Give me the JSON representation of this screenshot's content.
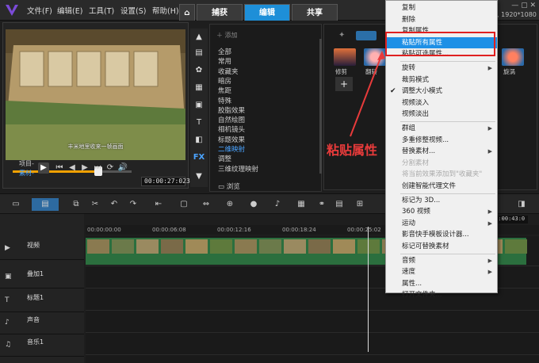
{
  "menubar": {
    "items": [
      "文件(F)",
      "编辑(E)",
      "工具(T)",
      "设置(S)",
      "帮助(H)"
    ],
    "tabs": [
      {
        "label": "捕获"
      },
      {
        "label": "编辑"
      },
      {
        "label": "共享"
      }
    ],
    "resolution": "5, 1920*1080"
  },
  "preview": {
    "subtitle": "丰米地里收来一帧画面",
    "project_label": "项目-",
    "clip_label": "素材-",
    "timecode": "00:00:27:023"
  },
  "library": {
    "add_label": "添加",
    "categories": [
      "全部",
      "常用",
      "收藏夹",
      "暗房",
      "焦距",
      "特殊",
      "胶脂效果",
      "自然绘图",
      "相机镜头",
      "标题效果",
      "二维映射",
      "调整",
      "三维纹理映射"
    ],
    "selected_index": 10,
    "browse_label": "浏览",
    "fx_tab_label": "FX"
  },
  "effects": [
    {
      "label": "修剪"
    },
    {
      "label": "翻转"
    },
    {
      "label": "旋涡"
    }
  ],
  "annotation": {
    "text": "粘贴属性"
  },
  "context_menu": {
    "items": [
      {
        "label": "复制",
        "state": "normal"
      },
      {
        "label": "删除",
        "state": "normal"
      },
      {
        "label": "复制属性",
        "state": "normal"
      },
      {
        "label": "粘贴所有属性",
        "state": "highlight"
      },
      {
        "label": "粘贴可选属性...",
        "state": "normal"
      },
      {
        "label": "旋转",
        "state": "submenu"
      },
      {
        "label": "裁剪模式",
        "state": "normal"
      },
      {
        "label": "调整大小模式",
        "state": "checked"
      },
      {
        "label": "视频淡入",
        "state": "normal"
      },
      {
        "label": "视频淡出",
        "state": "normal"
      },
      {
        "label": "群组",
        "state": "submenu"
      },
      {
        "label": "多重修整视频...",
        "state": "normal"
      },
      {
        "label": "替换素材...",
        "state": "submenu"
      },
      {
        "label": "分割素材",
        "state": "disabled"
      },
      {
        "label": "将当前效果添加到\"收藏夹\"",
        "state": "disabled"
      },
      {
        "label": "创建智能代理文件",
        "state": "normal"
      },
      {
        "label": "标记为 3D...",
        "state": "normal"
      },
      {
        "label": "360 视频",
        "state": "submenu"
      },
      {
        "label": "运动",
        "state": "submenu"
      },
      {
        "label": "影音快手模板设计器...",
        "state": "normal"
      },
      {
        "label": "标记可替换素材",
        "state": "normal"
      },
      {
        "label": "音频",
        "state": "submenu"
      },
      {
        "label": "速度",
        "state": "submenu"
      },
      {
        "label": "属性...",
        "state": "normal"
      },
      {
        "label": "打开文件夹...",
        "state": "normal"
      }
    ]
  },
  "timeline": {
    "ruler": [
      "00:00:00:00",
      "00:00:06:08",
      "00:00:12:16",
      "00:00:18:24",
      "00:00:25:02"
    ],
    "time_readout": "00:00:43:0",
    "tracks": [
      {
        "name": "视频",
        "icon": "video-track-icon"
      },
      {
        "name": "叠加1",
        "icon": "overlay-track-icon"
      },
      {
        "name": "标题1",
        "icon": "title-track-icon"
      },
      {
        "name": "声音",
        "icon": "voice-track-icon"
      },
      {
        "name": "音乐1",
        "icon": "music-track-icon"
      }
    ]
  }
}
